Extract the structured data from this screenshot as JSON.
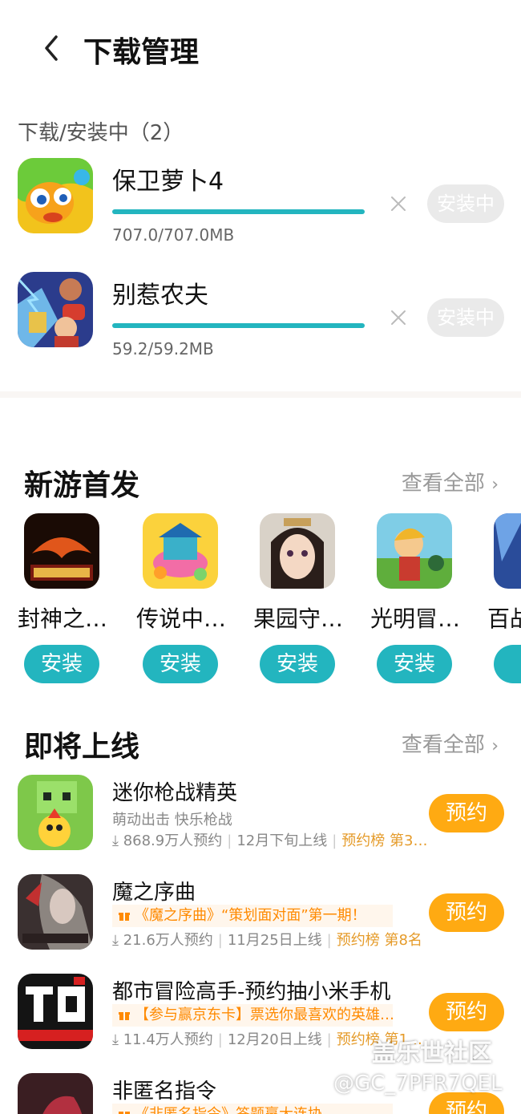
{
  "header": {
    "title": "下载管理"
  },
  "downloading": {
    "label": "下载/安装中（2）",
    "items": [
      {
        "name": "保卫萝卜4",
        "size": "707.0/707.0MB",
        "status": "安装中"
      },
      {
        "name": "别惹农夫",
        "size": "59.2/59.2MB",
        "status": "安装中"
      }
    ]
  },
  "new_games": {
    "title": "新游首发",
    "see_all": "查看全部",
    "items": [
      {
        "name": "封神之…",
        "button": "安装"
      },
      {
        "name": "传说中…",
        "button": "安装"
      },
      {
        "name": "果园守…",
        "button": "安装"
      },
      {
        "name": "光明冒…",
        "button": "安装"
      },
      {
        "name": "百战",
        "button": "安"
      }
    ]
  },
  "upcoming": {
    "title": "即将上线",
    "see_all": "查看全部",
    "items": [
      {
        "name": "迷你枪战精英",
        "tags": "萌动出击  快乐枪战",
        "reservations": "868.9万人预约",
        "date": "12月下旬上线",
        "rank": "预约榜 第3…",
        "button": "预约"
      },
      {
        "name": "魔之序曲",
        "promo": "《魔之序曲》“策划面对面”第一期！",
        "reservations": "21.6万人预约",
        "date": "11月25日上线",
        "rank": "预约榜 第8名",
        "button": "预约"
      },
      {
        "name": "都市冒险高手-预约抽小米手机",
        "promo": "【参与赢京东卡】票选你最喜欢的英雄…",
        "reservations": "11.4万人预约",
        "date": "12月20日上线",
        "rank": "预约榜 第1…",
        "button": "预约"
      },
      {
        "name": "非匿名指令",
        "promo": "《非匿名指令》答题赢大连协",
        "button": "预约"
      }
    ]
  },
  "watermark": {
    "brand": "盖乐世社区",
    "user": "@GC_7PFR7QEL"
  },
  "colors": {
    "accent": "#23b5bf",
    "reserve": "#ffaa12",
    "status_bg": "#eaeaea"
  }
}
